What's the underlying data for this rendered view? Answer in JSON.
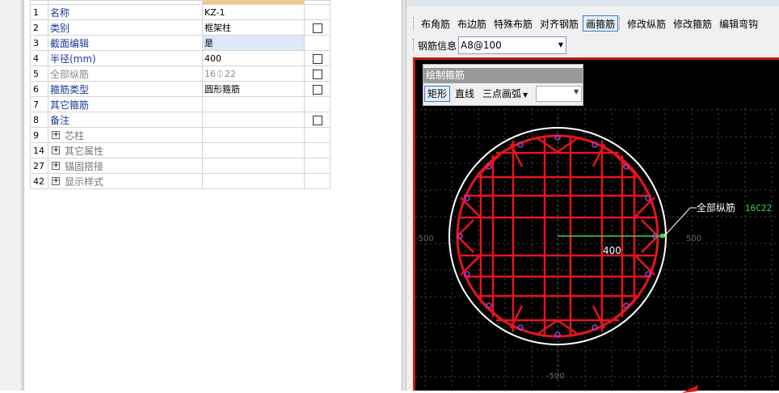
{
  "properties": {
    "rows": [
      {
        "num": "1",
        "name": "名称",
        "value": "KZ-1",
        "checkbox": false
      },
      {
        "num": "2",
        "name": "类别",
        "value": "框架柱",
        "checkbox": true
      },
      {
        "num": "3",
        "name": "截面编辑",
        "value": "是",
        "checkbox": false
      },
      {
        "num": "4",
        "name": "半径(mm)",
        "value": "400",
        "checkbox": true
      },
      {
        "num": "5",
        "name": "全部纵筋",
        "value": "16⏀22",
        "checkbox": true
      },
      {
        "num": "6",
        "name": "箍筋类型",
        "value": "圆形箍筋",
        "checkbox": true
      },
      {
        "num": "7",
        "name": "其它箍筋",
        "value": "",
        "checkbox": false
      },
      {
        "num": "8",
        "name": "备注",
        "value": "",
        "checkbox": true
      }
    ],
    "groups": [
      {
        "num": "9",
        "name": "芯柱"
      },
      {
        "num": "14",
        "name": "其它属性"
      },
      {
        "num": "27",
        "name": "锚固搭接"
      },
      {
        "num": "42",
        "name": "显示样式"
      }
    ]
  },
  "toolbar": {
    "buttons": [
      "布角筋",
      "布边筋",
      "特殊布筋",
      "对齐钢筋",
      "画箍筋",
      "修改纵筋",
      "修改箍筋",
      "编辑弯钩"
    ],
    "active": "画箍筋",
    "rebar_info_label": "钢筋信息",
    "rebar_info_value": "A8@100"
  },
  "draw_panel": {
    "title": "绘制箍筋",
    "buttons": [
      "矩形",
      "直线",
      "三点画弧"
    ],
    "active": "矩形"
  },
  "canvas": {
    "dimension_label": "400",
    "annotation_label": "全部纵筋",
    "annotation_value": "16C22",
    "axis_left": "-500",
    "axis_right": "500",
    "axis_bottom": "-500",
    "colors": {
      "stirrup": "#e8141e",
      "outline": "#ffffff",
      "annotation": "#3cdc3c",
      "grid": "#5a5a5a",
      "bar": "#a040d0",
      "background": "#000000"
    }
  }
}
